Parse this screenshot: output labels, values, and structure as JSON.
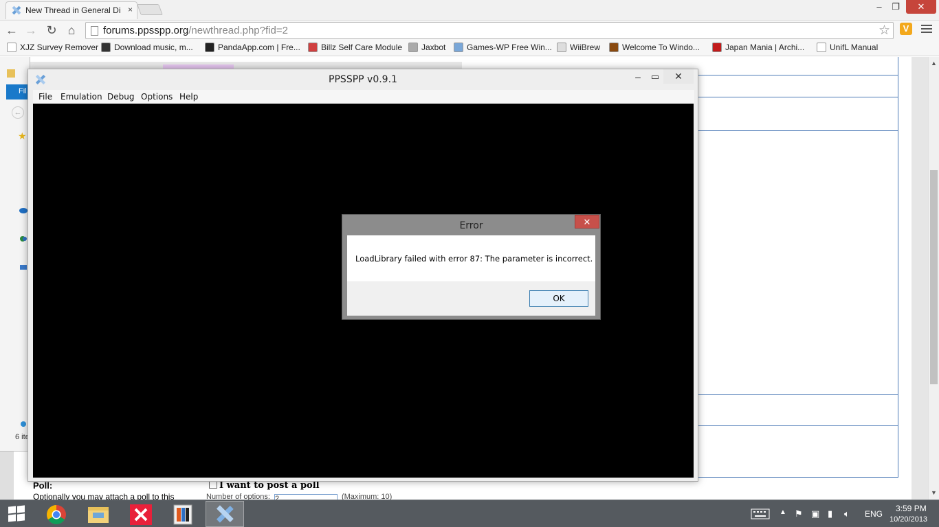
{
  "browser": {
    "tab_title": "New Thread in General Di",
    "tab_close": "×",
    "url_host": "forums.ppsspp.org",
    "url_path": "/newthread.php?fid=2",
    "window_min": "–",
    "window_max": "❐",
    "window_close": "✕",
    "bookmarks": [
      {
        "label": "XJZ Survey Remover",
        "icon": "page-icon",
        "color": "#ffffff"
      },
      {
        "label": "Download music, m...",
        "icon": "computer-icon",
        "color": "#333333"
      },
      {
        "label": "PandaApp.com | Fre...",
        "icon": "panda-icon",
        "color": "#222222"
      },
      {
        "label": "Billz Self Care Module",
        "icon": "dots-icon",
        "color": "#d04040"
      },
      {
        "label": "Jaxbot",
        "icon": "gear-icon",
        "color": "#aaaaaa"
      },
      {
        "label": "Games-WP Free Win...",
        "icon": "bars-icon",
        "color": "#7aa7d8"
      },
      {
        "label": "WiiBrew",
        "icon": "wii-icon",
        "color": "#dddddd"
      },
      {
        "label": "Welcome To Windo...",
        "icon": "globe-icon",
        "color": "#8a4a10"
      },
      {
        "label": "Japan Mania | Archi...",
        "icon": "flag-icon",
        "color": "#c21b1b"
      },
      {
        "label": "UnifL Manual",
        "icon": "page-icon",
        "color": "#ffffff"
      }
    ]
  },
  "forum_page": {
    "poll_label": "Poll:",
    "poll_desc": "Optionally you may attach a poll to this",
    "poll_checkbox_label": "I want to post a poll",
    "poll_options_label": "Number of options:",
    "poll_options_value": "2",
    "poll_options_max": "(Maximum: 10)"
  },
  "explorer": {
    "ribbon_label": "Fil",
    "item_count": "6 ite"
  },
  "ppsspp": {
    "title": "PPSSPP v0.9.1",
    "min": "–",
    "max": "▭",
    "close": "✕",
    "menu": [
      "File",
      "Emulation",
      "Debug",
      "Options",
      "Help"
    ]
  },
  "error_dialog": {
    "title": "Error",
    "close": "✕",
    "message": "LoadLibrary failed with error 87: The parameter is incorrect.",
    "ok_label": "OK"
  },
  "taskbar": {
    "apps": [
      "chrome",
      "file-explorer",
      "visual-studio",
      "paint-app",
      "ppsspp"
    ],
    "active_app": "ppsspp",
    "language": "ENG",
    "time": "3:59 PM",
    "date": "10/20/2013"
  },
  "colors": {
    "taskbar": "#555a5f",
    "close_red": "#c7504a",
    "forum_blue": "#4a78b5",
    "ribbon_blue": "#1979ca"
  }
}
